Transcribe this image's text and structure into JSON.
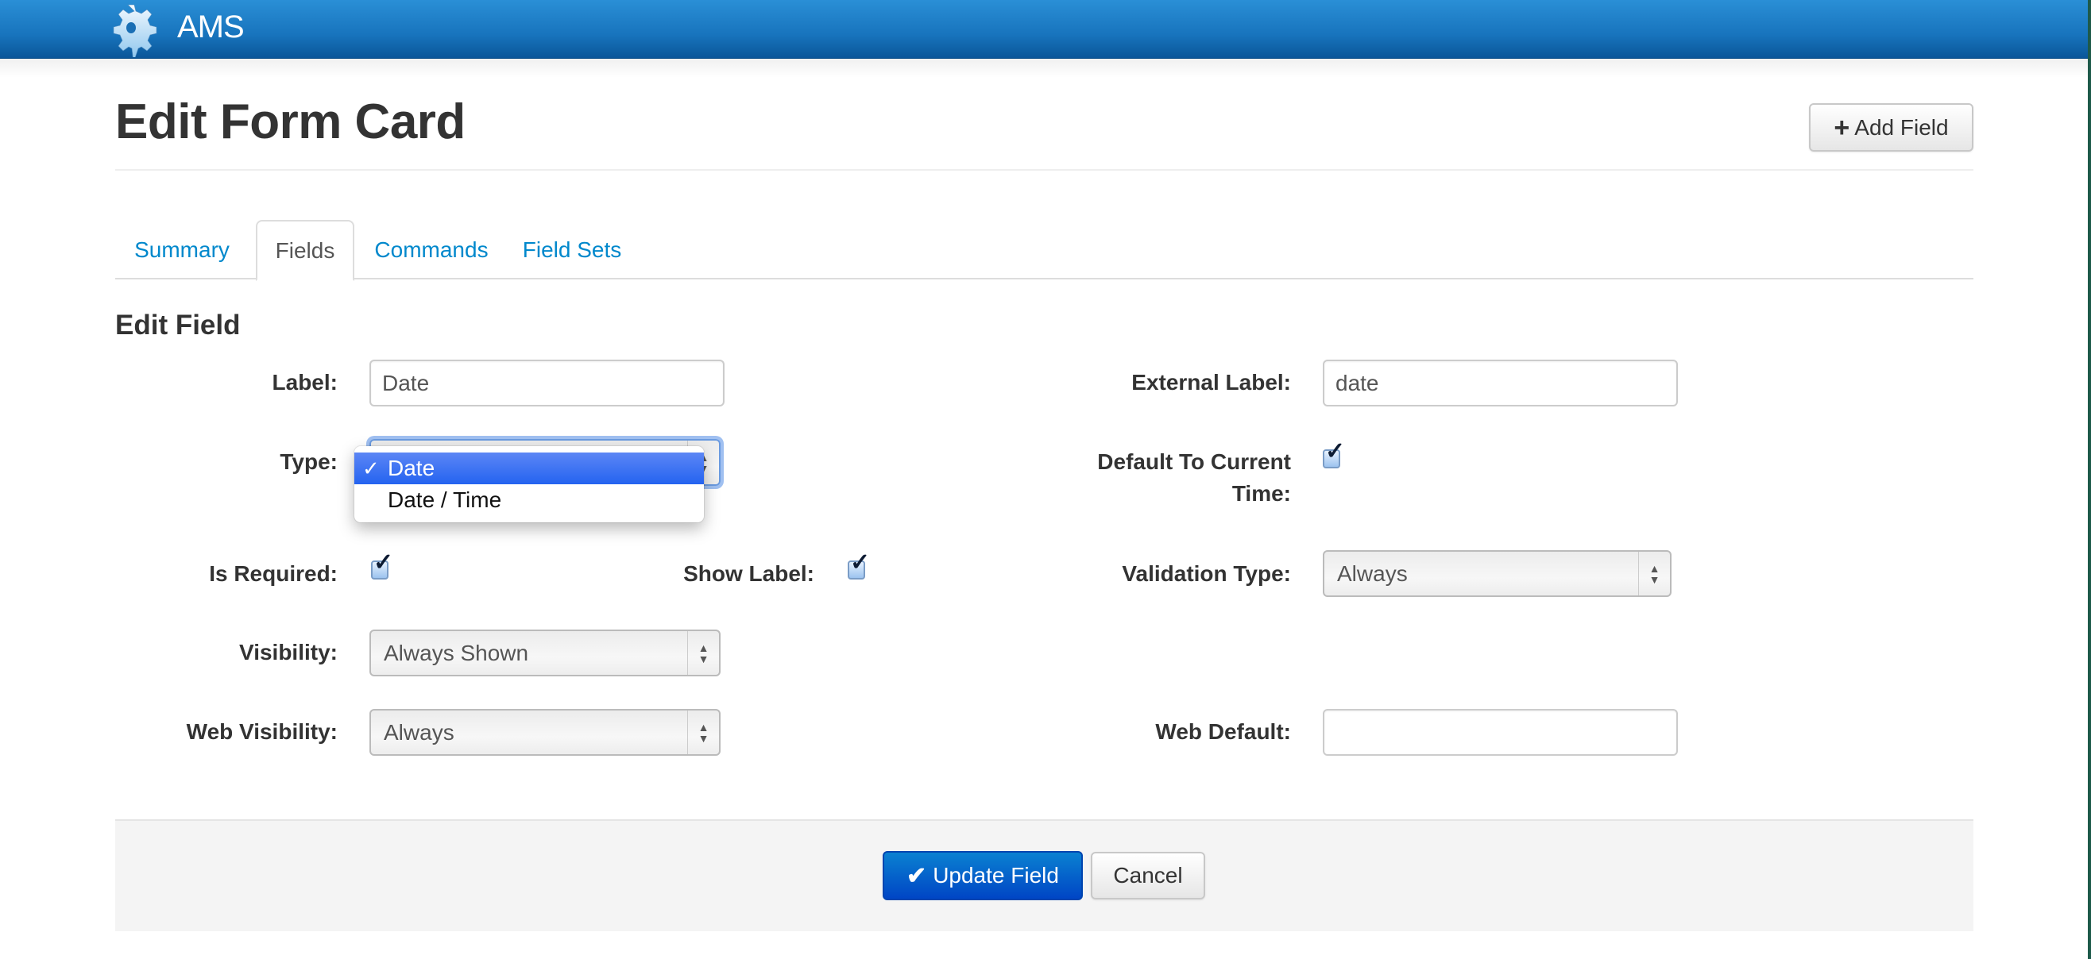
{
  "app": {
    "title": "AMS",
    "logo_icon": "gear-icon"
  },
  "header": {
    "title": "Edit Form Card",
    "add_field_label": "Add Field",
    "add_field_icon": "plus-icon"
  },
  "tabs": [
    {
      "label": "Summary",
      "active": false
    },
    {
      "label": "Fields",
      "active": true
    },
    {
      "label": "Commands",
      "active": false
    },
    {
      "label": "Field Sets",
      "active": false
    }
  ],
  "form": {
    "section_title": "Edit Field",
    "label": {
      "label": "Label:",
      "value": "Date"
    },
    "external_label": {
      "label": "External Label:",
      "value": "date"
    },
    "type": {
      "label": "Type:",
      "value": "Date",
      "options": [
        {
          "label": "Date",
          "selected": true
        },
        {
          "label": "Date / Time",
          "selected": false
        }
      ],
      "open": true
    },
    "default_to_current_time": {
      "label": "Default To Current Time:",
      "checked": true
    },
    "is_required": {
      "label": "Is Required:",
      "checked": true
    },
    "show_label": {
      "label": "Show Label:",
      "checked": true
    },
    "validation_type": {
      "label": "Validation Type:",
      "value": "Always"
    },
    "visibility": {
      "label": "Visibility:",
      "value": "Always Shown"
    },
    "web_visibility": {
      "label": "Web Visibility:",
      "value": "Always"
    },
    "web_default": {
      "label": "Web Default:",
      "value": ""
    }
  },
  "actions": {
    "update_label": "Update Field",
    "update_icon": "check-icon",
    "cancel_label": "Cancel"
  },
  "colors": {
    "navbar": "#1874bd",
    "link": "#0088cc",
    "primary": "#0a64cc",
    "dropdown_highlight": "#2f6cf2"
  }
}
